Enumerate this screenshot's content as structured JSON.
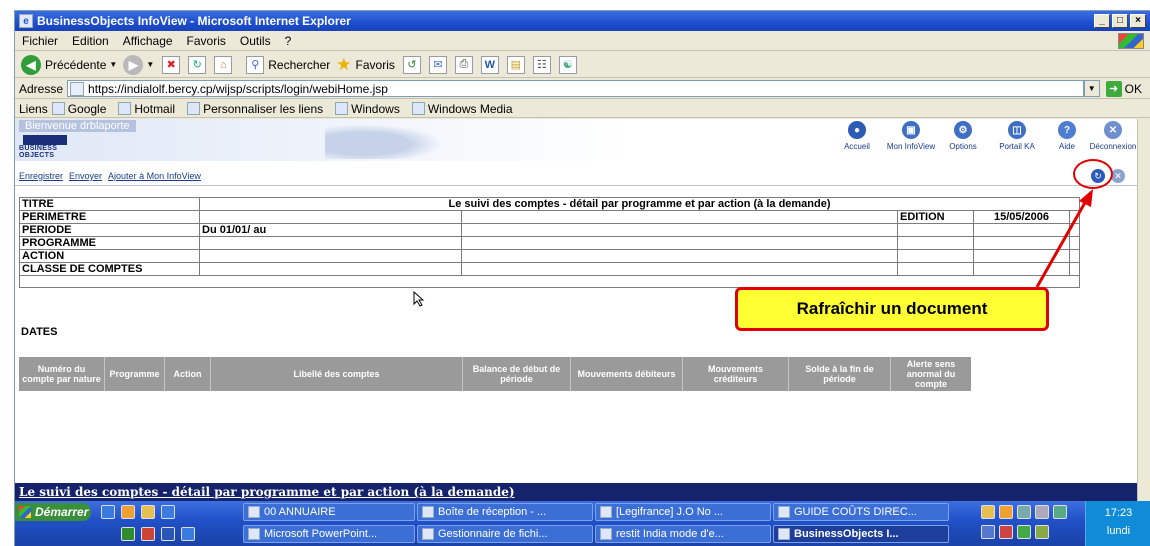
{
  "window": {
    "title": "BusinessObjects InfoView - Microsoft Internet Explorer",
    "controls": [
      "_",
      "□",
      "×"
    ]
  },
  "menu": [
    "Fichier",
    "Edition",
    "Affichage",
    "Favoris",
    "Outils",
    "?"
  ],
  "toolbar": {
    "back_label": "Précédente",
    "search_label": "Rechercher",
    "favorites_label": "Favoris"
  },
  "address": {
    "label": "Adresse",
    "url": "https://indialolf.bercy.cp/wijsp/scripts/login/webiHome.jsp",
    "go_label": "OK"
  },
  "links": {
    "label": "Liens",
    "items": [
      "Google",
      "Hotmail",
      "Personnaliser les liens",
      "Windows",
      "Windows Media"
    ]
  },
  "bo": {
    "welcome": "Bienvenue drblaporte",
    "logo_text": "BUSINESS OBJECTS",
    "nav": [
      {
        "label": "Accueil",
        "icon": "home-icon",
        "color": "#2a5bb5"
      },
      {
        "label": "Mon InfoView",
        "icon": "infoview-icon",
        "color": "#3e6fc4"
      },
      {
        "label": "Options",
        "icon": "options-icon",
        "color": "#3e6fc4"
      },
      {
        "label": "Portail KA",
        "icon": "portal-icon",
        "color": "#3e6fc4"
      },
      {
        "label": "Aide",
        "icon": "help-icon",
        "color": "#4f7ed0"
      },
      {
        "label": "Déconnexion",
        "icon": "logout-icon",
        "color": "#6f8fcf"
      }
    ],
    "actions": [
      "Enregistrer",
      "Envoyer",
      "Ajouter à Mon InfoView"
    ]
  },
  "report": {
    "rows": [
      {
        "label": "TITRE"
      },
      {
        "label": "PERIMETRE"
      },
      {
        "label": "PERIODE",
        "value": "Du 01/01/ au"
      },
      {
        "label": "PROGRAMME"
      },
      {
        "label": "ACTION"
      },
      {
        "label": "CLASSE DE COMPTES"
      }
    ],
    "title": "Le suivi des comptes - détail par programme et par action (à la demande)",
    "edition_label": "EDITION",
    "edition_date": "15/05/2006",
    "dates_label": "DATES",
    "columns": [
      "Numéro du compte par nature",
      "Programme",
      "Action",
      "Libellé des comptes",
      "Balance de début de période",
      "Mouvements débiteurs",
      "Mouvements créditeurs",
      "Solde à la fin de période",
      "Alerte sens anormal du compte"
    ],
    "footer_title": "Le suivi des comptes - détail par programme et par action (à la demande)"
  },
  "callout": {
    "text": "Rafraîchir un document",
    "border_color": "#e00000",
    "fill_color": "#ffff33"
  },
  "taskbar": {
    "start_label": "Démarrer",
    "tasks_row1": [
      "00 ANNUAIRE",
      "Boîte de réception - ...",
      "[Legifrance] J.O No ...",
      "GUIDE COÛTS DIREC..."
    ],
    "tasks_row2": [
      "Microsoft PowerPoint...",
      "Gestionnaire de fichi...",
      "restit India mode d'e...",
      "BusinessObjects I..."
    ],
    "time": "17:23",
    "day": "lundi"
  }
}
